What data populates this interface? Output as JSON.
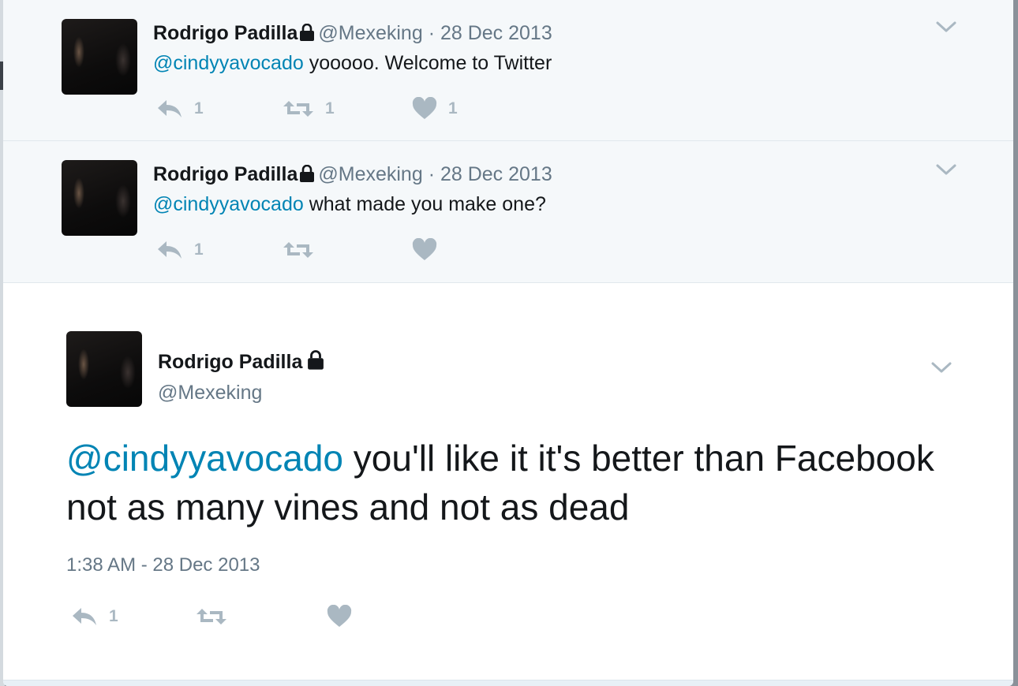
{
  "tweets": [
    {
      "name": "Rodrigo Padilla",
      "handle": "@Mexeking",
      "separator": "·",
      "date": "28 Dec 2013",
      "mention": "@cindyyavocado",
      "text": " yooooo. Welcome to Twitter",
      "reply_count": "1",
      "retweet_count": "1",
      "like_count": "1"
    },
    {
      "name": "Rodrigo Padilla",
      "handle": "@Mexeking",
      "separator": "·",
      "date": "28 Dec 2013",
      "mention": "@cindyyavocado",
      "text": " what made you make one?",
      "reply_count": "1"
    }
  ],
  "focal": {
    "name": "Rodrigo Padilla",
    "handle": "@Mexeking",
    "mention": "@cindyyavocado",
    "text": " you'll like it it's better than Facebook not as many vines and not as dead",
    "timestamp": "1:38 AM - 28 Dec 2013",
    "reply_count": "1"
  },
  "colors": {
    "mention": "#0084b4",
    "secondary_text": "#657786",
    "action_icon": "#aab8c2",
    "ancestor_bg": "#f5f8fa"
  },
  "icons": [
    "lock-icon",
    "reply-icon",
    "retweet-icon",
    "heart-icon",
    "chevron-down-icon"
  ]
}
